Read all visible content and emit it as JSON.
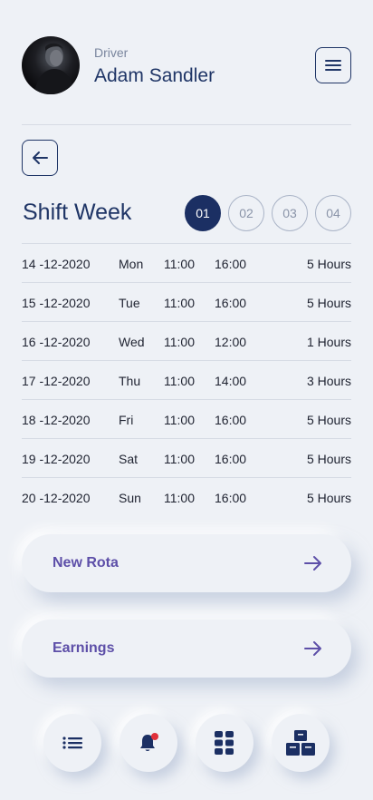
{
  "profile": {
    "role": "Driver",
    "name": "Adam Sandler"
  },
  "shift": {
    "title": "Shift Week",
    "weeks": [
      "01",
      "02",
      "03",
      "04"
    ],
    "active_week": "01",
    "rows": [
      {
        "date": "14 -12-2020",
        "day": "Mon",
        "start": "11:00",
        "end": "16:00",
        "hours": "5 Hours"
      },
      {
        "date": "15 -12-2020",
        "day": "Tue",
        "start": "11:00",
        "end": "16:00",
        "hours": "5 Hours"
      },
      {
        "date": "16 -12-2020",
        "day": "Wed",
        "start": "11:00",
        "end": "12:00",
        "hours": "1 Hours"
      },
      {
        "date": "17 -12-2020",
        "day": "Thu",
        "start": "11:00",
        "end": "14:00",
        "hours": "3 Hours"
      },
      {
        "date": "18 -12-2020",
        "day": "Fri",
        "start": "11:00",
        "end": "16:00",
        "hours": "5 Hours"
      },
      {
        "date": "19 -12-2020",
        "day": "Sat",
        "start": "11:00",
        "end": "16:00",
        "hours": "5 Hours"
      },
      {
        "date": "20 -12-2020",
        "day": "Sun",
        "start": "11:00",
        "end": "16:00",
        "hours": "5 Hours"
      }
    ]
  },
  "actions": {
    "new_rota": "New Rota",
    "earnings": "Earnings"
  },
  "icons": {
    "menu": "hamburger-menu-icon",
    "back": "arrow-left-icon",
    "action_arrow": "arrow-right-icon",
    "nav": [
      "list-icon",
      "bell-icon",
      "grid-icon",
      "boxes-icon"
    ]
  },
  "colors": {
    "primary": "#1b2f63",
    "accent": "#5d4fa8",
    "notification": "#e0303a",
    "background": "#eef1f6"
  }
}
